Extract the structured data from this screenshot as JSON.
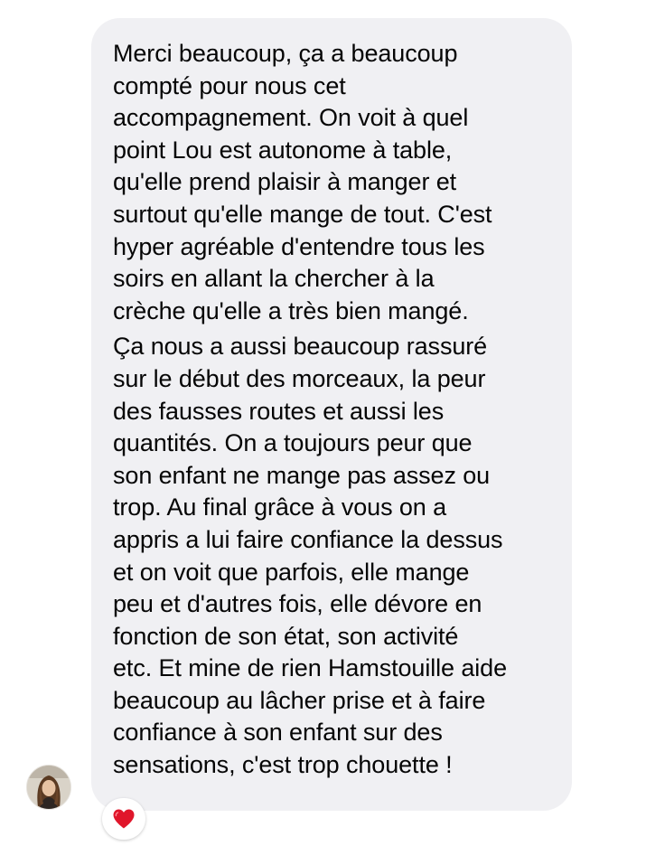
{
  "message": {
    "paragraphs": [
      "Merci beaucoup, ça a beaucoup\ncompté pour nous cet\naccompagnement. On voit à quel\npoint Lou est autonome à table,\nqu'elle prend plaisir à manger et\nsurtout qu'elle mange de tout. C'est\nhyper agréable d'entendre tous les\nsoirs en allant la chercher à la\ncrèche qu'elle a très bien mangé.",
      "Ça nous a aussi beaucoup rassuré\nsur le début des morceaux, la peur\ndes fausses routes et aussi les\nquantités. On a toujours peur que\nson enfant ne mange pas assez ou\ntrop. Au final grâce à vous on a\nappris a lui faire confiance la dessus\net on voit que parfois, elle mange\npeu et d'autres fois, elle dévore en\nfonction de son état, son activité\netc. Et mine de rien Hamstouille aide\nbeaucoup au lâcher prise et à faire\nconfiance à son enfant sur des\nsensations, c'est trop chouette !"
    ],
    "bubble_color": "#f0f0f3",
    "text_color": "#050505"
  },
  "sender": {
    "avatar_icon": "profile-photo-avatar"
  },
  "reaction": {
    "icon": "red-heart-icon",
    "color": "#e0162b"
  }
}
